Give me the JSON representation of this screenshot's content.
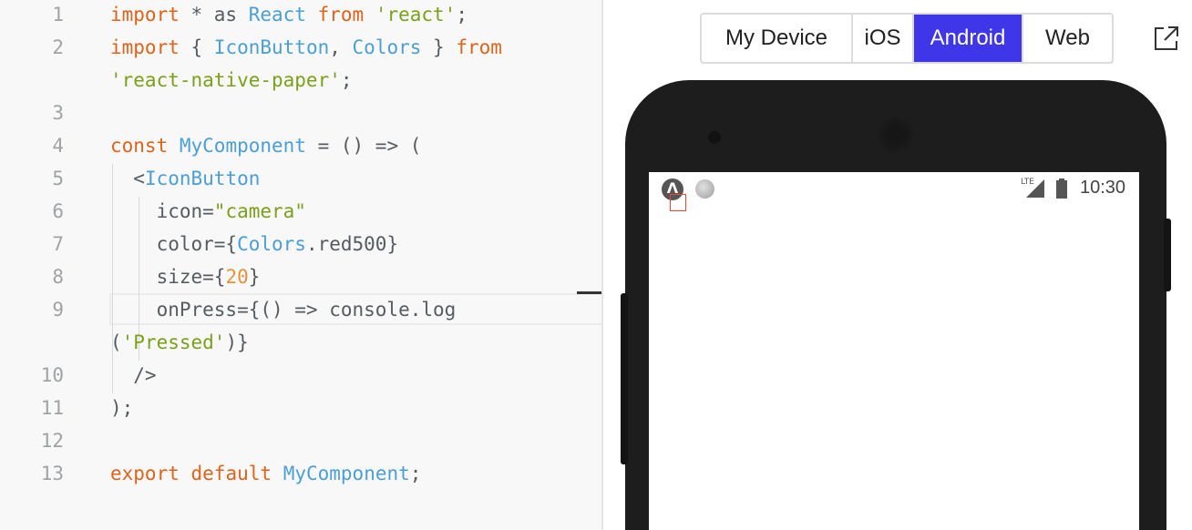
{
  "editor": {
    "lines": [
      {
        "num": "1",
        "tokens": [
          [
            "kw",
            "import"
          ],
          [
            "plain",
            " * as "
          ],
          [
            "id",
            "React"
          ],
          [
            "plain",
            " "
          ],
          [
            "kw",
            "from"
          ],
          [
            "plain",
            " "
          ],
          [
            "str",
            "'react'"
          ],
          [
            "plain",
            ";"
          ]
        ]
      },
      {
        "num": "2",
        "tokens": [
          [
            "kw",
            "import"
          ],
          [
            "plain",
            " { "
          ],
          [
            "id",
            "IconButton"
          ],
          [
            "plain",
            ", "
          ],
          [
            "id",
            "Colors"
          ],
          [
            "plain",
            " } "
          ],
          [
            "kw",
            "from"
          ]
        ]
      },
      {
        "num": "",
        "tokens": [
          [
            "str",
            "'react-native-paper'"
          ],
          [
            "plain",
            ";"
          ]
        ]
      },
      {
        "num": "3",
        "tokens": []
      },
      {
        "num": "4",
        "tokens": [
          [
            "kw",
            "const"
          ],
          [
            "plain",
            " "
          ],
          [
            "id",
            "MyComponent"
          ],
          [
            "plain",
            " = () => ("
          ]
        ]
      },
      {
        "num": "5",
        "tokens": [
          [
            "plain",
            "  <"
          ],
          [
            "id",
            "IconButton"
          ]
        ]
      },
      {
        "num": "6",
        "tokens": [
          [
            "plain",
            "    icon="
          ],
          [
            "str",
            "\"camera\""
          ]
        ]
      },
      {
        "num": "7",
        "tokens": [
          [
            "plain",
            "    color={"
          ],
          [
            "id",
            "Colors"
          ],
          [
            "plain",
            ".red500}"
          ]
        ]
      },
      {
        "num": "8",
        "tokens": [
          [
            "plain",
            "    size={"
          ],
          [
            "num",
            "20"
          ],
          [
            "plain",
            "}"
          ]
        ]
      },
      {
        "num": "9",
        "tokens": [
          [
            "plain",
            "    onPress={() => console.log"
          ]
        ]
      },
      {
        "num": "",
        "tokens": [
          [
            "plain",
            "("
          ],
          [
            "str",
            "'Pressed'"
          ],
          [
            "plain",
            ")}"
          ]
        ]
      },
      {
        "num": "10",
        "tokens": [
          [
            "plain",
            "  />"
          ]
        ]
      },
      {
        "num": "11",
        "tokens": [
          [
            "plain",
            ");"
          ]
        ]
      },
      {
        "num": "12",
        "tokens": []
      },
      {
        "num": "13",
        "tokens": [
          [
            "kw",
            "export"
          ],
          [
            "plain",
            " "
          ],
          [
            "kw",
            "default"
          ],
          [
            "plain",
            " "
          ],
          [
            "id",
            "MyComponent"
          ],
          [
            "plain",
            ";"
          ]
        ]
      }
    ]
  },
  "platforms": {
    "items": [
      {
        "label": "My Device",
        "active": false
      },
      {
        "label": "iOS",
        "active": false
      },
      {
        "label": "Android",
        "active": true
      },
      {
        "label": "Web",
        "active": false
      }
    ]
  },
  "device": {
    "status_time": "10:30",
    "status_network": "LTE",
    "status_app_glyph": "Λ"
  },
  "icons": {
    "open_external": "open-in-new-window-icon",
    "camera": "camera-icon"
  },
  "colors": {
    "keyword": "#e0631b",
    "identifier": "#4b9fd6",
    "string": "#79a11b",
    "number": "#e7923b",
    "active_platform": "#3f36ea",
    "icon_button": "#f44336"
  }
}
